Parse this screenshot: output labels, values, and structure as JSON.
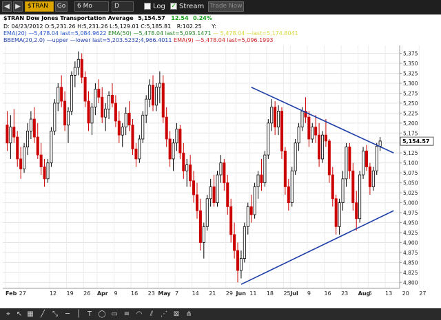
{
  "toolbar": {
    "symbol": "$TRAN",
    "go_label": "Go",
    "period": "6 Mo",
    "interval": "D",
    "log_label": "Log",
    "stream_label": "Stream",
    "trade_now_label": "Trade Now",
    "stream_checked": "✓"
  },
  "header": {
    "symbol_name": "$TRAN Dow Jones Transportation Average",
    "last_price": "5,154.57",
    "change": "12.54",
    "change_pct": "0.24%",
    "ohlc_line": "D: 04/23/2012 O:5,231.26 H:5,231.26 L:5,129.01 C:5,185.81",
    "r_value": "R:102.25",
    "y_label": "Y:",
    "ema20": "EMA(20) —5,478.04 last=5,084.9622",
    "ema50": "EMA(50) —5,478.04 last=5,093.1471",
    "ema_faded": "— 5,478.04 —last=5,174.8041",
    "bbema": "BBEMA(20,2.0) —upper —lower last=5,203.5232;4,966.4011",
    "ema9": "EMA(9) —5,478.04 last=5,096.1993"
  },
  "colors": {
    "up": "#000000",
    "down": "#cc0000",
    "trendline": "#1f3fa8",
    "ema20": "#2255cc",
    "ema50": "#228822",
    "ema9": "#cc2222",
    "ema_faded": "#d8d840",
    "price_tag_bg": "#ffffff",
    "green": "#1aa01a"
  },
  "chart_data": {
    "type": "candlestick",
    "ylim": [
      4785,
      5395
    ],
    "y_ticks": [
      "5,375",
      "5,350",
      "5,325",
      "5,300",
      "5,275",
      "5,250",
      "5,225",
      "5,200",
      "5,175",
      "5,150",
      "5,125",
      "5,100",
      "5,075",
      "5,050",
      "5,025",
      "5,000",
      "4,975",
      "4,950",
      "4,925",
      "4,900",
      "4,875",
      "4,850",
      "4,825",
      "4,800"
    ],
    "x_tick_labels": [
      "Feb",
      "27",
      "12",
      "19",
      "26",
      "Apr",
      "9",
      "16",
      "23",
      "May",
      "7",
      "14",
      "21",
      "29",
      "Jun",
      "11",
      "18",
      "25",
      "Jul",
      "9",
      "16",
      "23",
      "Aug",
      "6",
      "13",
      "20",
      "27"
    ],
    "x_tick_months": [
      "Feb",
      "Apr",
      "May",
      "Jun",
      "Jul",
      "Aug"
    ],
    "last_price_tag": "5,154.57",
    "candles": [
      {
        "o": 5195,
        "h": 5230,
        "l": 5130,
        "c": 5150
      },
      {
        "o": 5150,
        "h": 5220,
        "l": 5110,
        "c": 5190
      },
      {
        "o": 5190,
        "h": 5235,
        "l": 5150,
        "c": 5165
      },
      {
        "o": 5165,
        "h": 5180,
        "l": 5090,
        "c": 5110
      },
      {
        "o": 5110,
        "h": 5140,
        "l": 5060,
        "c": 5085
      },
      {
        "o": 5085,
        "h": 5150,
        "l": 5075,
        "c": 5140
      },
      {
        "o": 5140,
        "h": 5200,
        "l": 5120,
        "c": 5180
      },
      {
        "o": 5180,
        "h": 5230,
        "l": 5160,
        "c": 5210
      },
      {
        "o": 5210,
        "h": 5240,
        "l": 5150,
        "c": 5165
      },
      {
        "o": 5165,
        "h": 5200,
        "l": 5110,
        "c": 5120
      },
      {
        "o": 5120,
        "h": 5150,
        "l": 5070,
        "c": 5090
      },
      {
        "o": 5090,
        "h": 5110,
        "l": 5040,
        "c": 5060
      },
      {
        "o": 5060,
        "h": 5110,
        "l": 5050,
        "c": 5100
      },
      {
        "o": 5100,
        "h": 5190,
        "l": 5090,
        "c": 5180
      },
      {
        "o": 5180,
        "h": 5260,
        "l": 5170,
        "c": 5250
      },
      {
        "o": 5250,
        "h": 5300,
        "l": 5230,
        "c": 5290
      },
      {
        "o": 5290,
        "h": 5320,
        "l": 5240,
        "c": 5255
      },
      {
        "o": 5255,
        "h": 5280,
        "l": 5180,
        "c": 5195
      },
      {
        "o": 5195,
        "h": 5240,
        "l": 5150,
        "c": 5230
      },
      {
        "o": 5230,
        "h": 5330,
        "l": 5220,
        "c": 5320
      },
      {
        "o": 5320,
        "h": 5355,
        "l": 5290,
        "c": 5340
      },
      {
        "o": 5340,
        "h": 5380,
        "l": 5320,
        "c": 5360
      },
      {
        "o": 5360,
        "h": 5375,
        "l": 5300,
        "c": 5315
      },
      {
        "o": 5315,
        "h": 5330,
        "l": 5240,
        "c": 5255
      },
      {
        "o": 5255,
        "h": 5280,
        "l": 5180,
        "c": 5200
      },
      {
        "o": 5200,
        "h": 5250,
        "l": 5170,
        "c": 5240
      },
      {
        "o": 5240,
        "h": 5300,
        "l": 5220,
        "c": 5285
      },
      {
        "o": 5285,
        "h": 5310,
        "l": 5250,
        "c": 5265
      },
      {
        "o": 5265,
        "h": 5290,
        "l": 5200,
        "c": 5215
      },
      {
        "o": 5215,
        "h": 5250,
        "l": 5180,
        "c": 5235
      },
      {
        "o": 5235,
        "h": 5280,
        "l": 5210,
        "c": 5270
      },
      {
        "o": 5270,
        "h": 5300,
        "l": 5240,
        "c": 5250
      },
      {
        "o": 5250,
        "h": 5270,
        "l": 5190,
        "c": 5205
      },
      {
        "o": 5205,
        "h": 5230,
        "l": 5150,
        "c": 5170
      },
      {
        "o": 5170,
        "h": 5200,
        "l": 5140,
        "c": 5190
      },
      {
        "o": 5190,
        "h": 5240,
        "l": 5170,
        "c": 5225
      },
      {
        "o": 5225,
        "h": 5255,
        "l": 5180,
        "c": 5195
      },
      {
        "o": 5195,
        "h": 5210,
        "l": 5120,
        "c": 5135
      },
      {
        "o": 5135,
        "h": 5150,
        "l": 5090,
        "c": 5110
      },
      {
        "o": 5110,
        "h": 5170,
        "l": 5100,
        "c": 5160
      },
      {
        "o": 5160,
        "h": 5230,
        "l": 5150,
        "c": 5220
      },
      {
        "o": 5220,
        "h": 5270,
        "l": 5200,
        "c": 5260
      },
      {
        "o": 5260,
        "h": 5310,
        "l": 5240,
        "c": 5295
      },
      {
        "o": 5295,
        "h": 5320,
        "l": 5230,
        "c": 5245
      },
      {
        "o": 5245,
        "h": 5300,
        "l": 5230,
        "c": 5290
      },
      {
        "o": 5290,
        "h": 5330,
        "l": 5250,
        "c": 5300
      },
      {
        "o": 5300,
        "h": 5320,
        "l": 5200,
        "c": 5215
      },
      {
        "o": 5215,
        "h": 5240,
        "l": 5140,
        "c": 5160
      },
      {
        "o": 5160,
        "h": 5180,
        "l": 5090,
        "c": 5110
      },
      {
        "o": 5110,
        "h": 5160,
        "l": 5080,
        "c": 5150
      },
      {
        "o": 5150,
        "h": 5200,
        "l": 5130,
        "c": 5185
      },
      {
        "o": 5185,
        "h": 5195,
        "l": 5110,
        "c": 5125
      },
      {
        "o": 5125,
        "h": 5150,
        "l": 5060,
        "c": 5080
      },
      {
        "o": 5080,
        "h": 5110,
        "l": 5040,
        "c": 5095
      },
      {
        "o": 5095,
        "h": 5120,
        "l": 5040,
        "c": 5055
      },
      {
        "o": 5055,
        "h": 5080,
        "l": 5000,
        "c": 5020
      },
      {
        "o": 5020,
        "h": 5050,
        "l": 4960,
        "c": 4980
      },
      {
        "o": 4980,
        "h": 5010,
        "l": 4880,
        "c": 4900
      },
      {
        "o": 4900,
        "h": 4950,
        "l": 4860,
        "c": 4940
      },
      {
        "o": 4940,
        "h": 5020,
        "l": 4930,
        "c": 5010
      },
      {
        "o": 5010,
        "h": 5060,
        "l": 4990,
        "c": 5040
      },
      {
        "o": 5040,
        "h": 5070,
        "l": 4990,
        "c": 5000
      },
      {
        "o": 5000,
        "h": 5080,
        "l": 4990,
        "c": 5070
      },
      {
        "o": 5070,
        "h": 5120,
        "l": 5050,
        "c": 5100
      },
      {
        "o": 5100,
        "h": 5110,
        "l": 5030,
        "c": 5050
      },
      {
        "o": 5050,
        "h": 5070,
        "l": 4970,
        "c": 4990
      },
      {
        "o": 4990,
        "h": 5010,
        "l": 4900,
        "c": 4920
      },
      {
        "o": 4920,
        "h": 4950,
        "l": 4860,
        "c": 4880
      },
      {
        "o": 4880,
        "h": 4900,
        "l": 4800,
        "c": 4830
      },
      {
        "o": 4830,
        "h": 4880,
        "l": 4810,
        "c": 4860
      },
      {
        "o": 4860,
        "h": 4950,
        "l": 4850,
        "c": 4940
      },
      {
        "o": 4940,
        "h": 5000,
        "l": 4920,
        "c": 4990
      },
      {
        "o": 4990,
        "h": 5020,
        "l": 4950,
        "c": 4970
      },
      {
        "o": 4970,
        "h": 5050,
        "l": 4960,
        "c": 5040
      },
      {
        "o": 5040,
        "h": 5080,
        "l": 5010,
        "c": 5070
      },
      {
        "o": 5070,
        "h": 5110,
        "l": 5030,
        "c": 5050
      },
      {
        "o": 5050,
        "h": 5130,
        "l": 5040,
        "c": 5120
      },
      {
        "o": 5120,
        "h": 5210,
        "l": 5110,
        "c": 5200
      },
      {
        "o": 5200,
        "h": 5260,
        "l": 5180,
        "c": 5240
      },
      {
        "o": 5240,
        "h": 5255,
        "l": 5170,
        "c": 5190
      },
      {
        "o": 5190,
        "h": 5245,
        "l": 5170,
        "c": 5230
      },
      {
        "o": 5230,
        "h": 5240,
        "l": 5110,
        "c": 5130
      },
      {
        "o": 5130,
        "h": 5140,
        "l": 5020,
        "c": 5040
      },
      {
        "o": 5040,
        "h": 5060,
        "l": 4980,
        "c": 5000
      },
      {
        "o": 5000,
        "h": 5090,
        "l": 4990,
        "c": 5080
      },
      {
        "o": 5080,
        "h": 5160,
        "l": 5070,
        "c": 5150
      },
      {
        "o": 5150,
        "h": 5200,
        "l": 5130,
        "c": 5190
      },
      {
        "o": 5190,
        "h": 5240,
        "l": 5180,
        "c": 5230
      },
      {
        "o": 5230,
        "h": 5265,
        "l": 5200,
        "c": 5215
      },
      {
        "o": 5215,
        "h": 5230,
        "l": 5140,
        "c": 5160
      },
      {
        "o": 5160,
        "h": 5200,
        "l": 5150,
        "c": 5190
      },
      {
        "o": 5190,
        "h": 5220,
        "l": 5150,
        "c": 5170
      },
      {
        "o": 5170,
        "h": 5200,
        "l": 5090,
        "c": 5110
      },
      {
        "o": 5110,
        "h": 5180,
        "l": 5100,
        "c": 5170
      },
      {
        "o": 5170,
        "h": 5210,
        "l": 5140,
        "c": 5155
      },
      {
        "o": 5155,
        "h": 5160,
        "l": 5050,
        "c": 5070
      },
      {
        "o": 5070,
        "h": 5090,
        "l": 4990,
        "c": 5010
      },
      {
        "o": 5010,
        "h": 5020,
        "l": 4920,
        "c": 4940
      },
      {
        "o": 4940,
        "h": 5010,
        "l": 4920,
        "c": 5000
      },
      {
        "o": 5000,
        "h": 5080,
        "l": 4980,
        "c": 5060
      },
      {
        "o": 5060,
        "h": 5150,
        "l": 5040,
        "c": 5140
      },
      {
        "o": 5140,
        "h": 5150,
        "l": 5060,
        "c": 5080
      },
      {
        "o": 5080,
        "h": 5100,
        "l": 4980,
        "c": 5000
      },
      {
        "o": 5000,
        "h": 5030,
        "l": 4930,
        "c": 4960
      },
      {
        "o": 4960,
        "h": 5080,
        "l": 4950,
        "c": 5070
      },
      {
        "o": 5070,
        "h": 5140,
        "l": 5060,
        "c": 5130
      },
      {
        "o": 5130,
        "h": 5145,
        "l": 5080,
        "c": 5090
      },
      {
        "o": 5090,
        "h": 5100,
        "l": 5020,
        "c": 5040
      },
      {
        "o": 5040,
        "h": 5090,
        "l": 5030,
        "c": 5080
      },
      {
        "o": 5080,
        "h": 5150,
        "l": 5070,
        "c": 5142
      },
      {
        "o": 5142,
        "h": 5165,
        "l": 5130,
        "c": 5155
      }
    ],
    "trendlines": [
      {
        "from_index": 69,
        "from_value": 4795,
        "to_index": 114,
        "to_value": 4980
      },
      {
        "from_index": 72,
        "from_value": 5290,
        "to_index": 114,
        "to_value": 5125
      }
    ]
  }
}
